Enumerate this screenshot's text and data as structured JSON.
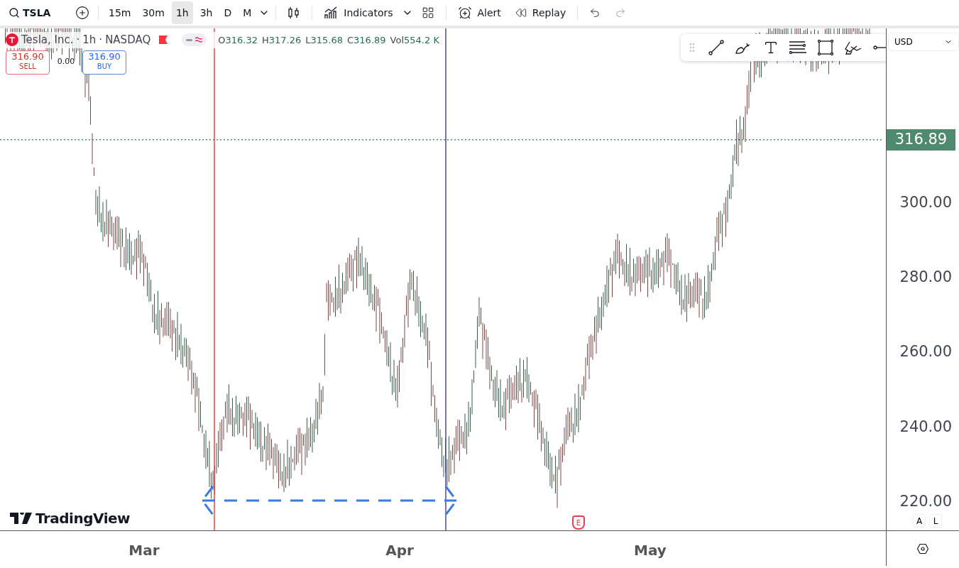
{
  "toolbar": {
    "symbol": "TSLA",
    "intervals": [
      {
        "label": "15m",
        "selected": false
      },
      {
        "label": "30m",
        "selected": false
      },
      {
        "label": "1h",
        "selected": true
      },
      {
        "label": "3h",
        "selected": false
      },
      {
        "label": "D",
        "selected": false
      },
      {
        "label": "M",
        "selected": false
      }
    ],
    "indicators": "Indicators",
    "alert": "Alert",
    "replay": "Replay"
  },
  "legend": {
    "name": "Tesla, Inc.",
    "interval": "1h",
    "exchange": "NASDAQ",
    "separators": [
      "·",
      "·"
    ],
    "ohlc": [
      {
        "label": "O",
        "value": "316.32"
      },
      {
        "label": "H",
        "value": "317.26"
      },
      {
        "label": "L",
        "value": "315.68"
      },
      {
        "label": "C",
        "value": "316.89"
      },
      {
        "label": "Vol",
        "value": "554.2 K"
      }
    ],
    "sell": {
      "price": "316.90",
      "label": "SELL"
    },
    "spread": "0.00",
    "buy": {
      "price": "316.90",
      "label": "BUY"
    }
  },
  "price_axis": {
    "currency": "USD",
    "labels": [
      "300.00",
      "280.00",
      "260.00",
      "240.00",
      "220.00"
    ],
    "last_price": "316.89",
    "buttons": [
      "A",
      "L"
    ]
  },
  "time_axis": {
    "labels": [
      "Mar",
      "Apr",
      "May"
    ]
  },
  "watermark": "TradingView",
  "event_marker": "E"
}
